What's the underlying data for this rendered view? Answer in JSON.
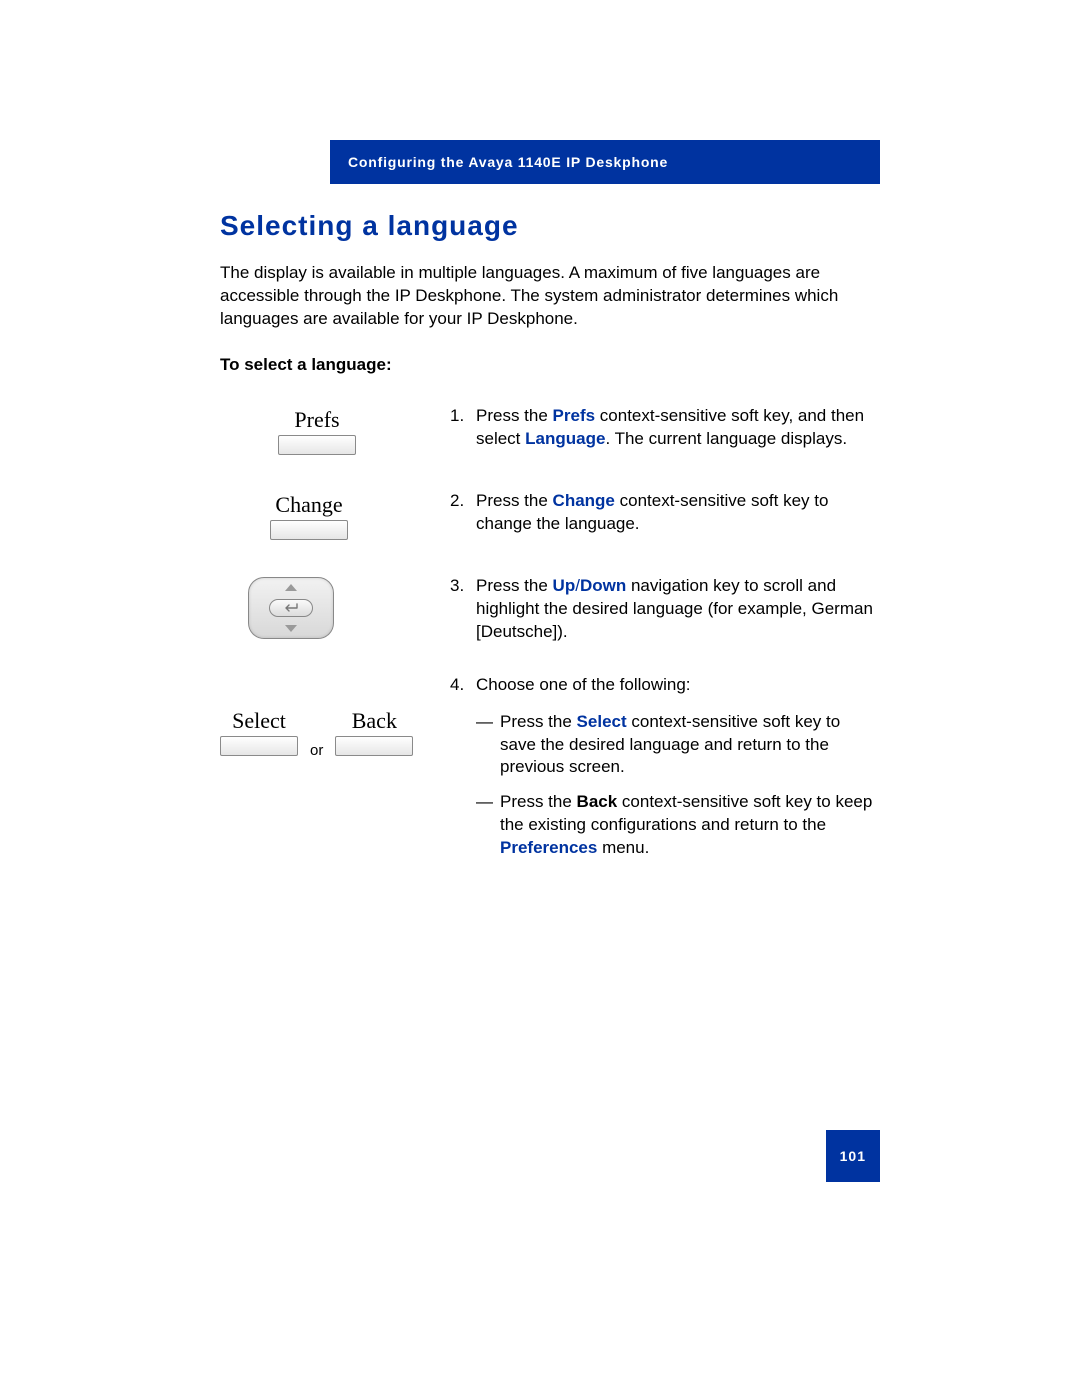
{
  "header": "Configuring the Avaya 1140E IP Deskphone",
  "title": "Selecting a language",
  "intro": "The display is available in multiple languages. A maximum of five languages are accessible through the IP Deskphone. The system administrator determines which languages are available for your IP Deskphone.",
  "subhead": "To select a language:",
  "softkeys": {
    "prefs": "Prefs",
    "change": "Change",
    "select": "Select",
    "back": "Back",
    "or": "or"
  },
  "steps": {
    "s1": {
      "num": "1.",
      "t1": "Press the ",
      "k1": "Prefs",
      "t2": " context-sensitive soft key, and then select ",
      "k2": "Language",
      "t3": ". The current language displays."
    },
    "s2": {
      "num": "2.",
      "t1": "Press the ",
      "k1": "Change",
      "t2": " context-sensitive soft key to change the language."
    },
    "s3": {
      "num": "3.",
      "t1": "Press the ",
      "k1": "Up",
      "slash": "/",
      "k2": "Down",
      "t2": " navigation key to scroll and highlight the desired language (for example, German [Deutsche])."
    },
    "s4": {
      "num": "4.",
      "t1": "Choose one of the following:",
      "a": {
        "t1": "Press the ",
        "k1": "Select",
        "t2": " context-sensitive soft key to save the desired language and return to the previous screen."
      },
      "b": {
        "t1": "Press the ",
        "k1": "Back",
        "t2": " context-sensitive soft key to keep the existing configurations and return to the ",
        "k2": "Preferences",
        "t3": " menu."
      }
    }
  },
  "dash": "—",
  "page_number": "101"
}
